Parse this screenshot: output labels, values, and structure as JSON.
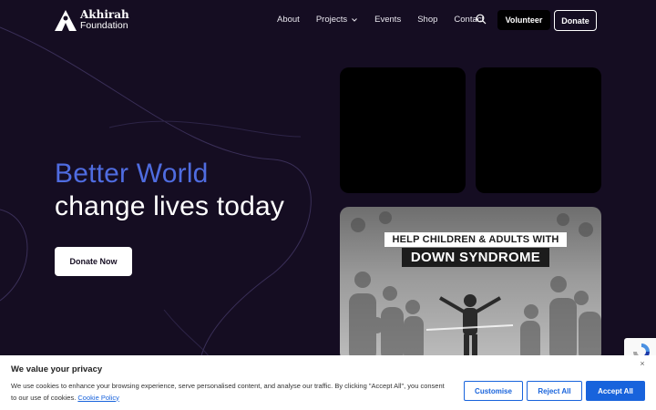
{
  "header": {
    "logo": {
      "line1": "Akhirah",
      "line2": "Foundation"
    },
    "nav": [
      {
        "label": "About"
      },
      {
        "label": "Projects"
      },
      {
        "label": "Events"
      },
      {
        "label": "Shop"
      },
      {
        "label": "Contact"
      }
    ],
    "volunteer_label": "Volunteer",
    "donate_label": "Donate"
  },
  "hero": {
    "title_accent": "Better World",
    "title_line2": "change lives today",
    "cta_label": "Donate Now",
    "feature_banner": {
      "line1": "HELP CHILDREN & ADULTS WITH",
      "line2": "DOWN SYNDROME"
    }
  },
  "cookie": {
    "title": "We value your privacy",
    "text": "We use cookies to enhance your browsing experience, serve personalised content, and analyse our traffic. By clicking \"Accept All\", you consent to our use of cookies.",
    "link": "Cookie Policy",
    "close": "×",
    "customise": "Customise",
    "reject": "Reject All",
    "accept": "Accept All"
  },
  "colors": {
    "background": "#150d22",
    "accent": "#4f6ce0",
    "cookie_primary": "#1863dc"
  },
  "icons": {
    "logo": "akhirah-logo-icon",
    "chevron": "chevron-down-icon",
    "search": "search-icon",
    "recaptcha": "recaptcha-icon",
    "close": "close-icon"
  }
}
